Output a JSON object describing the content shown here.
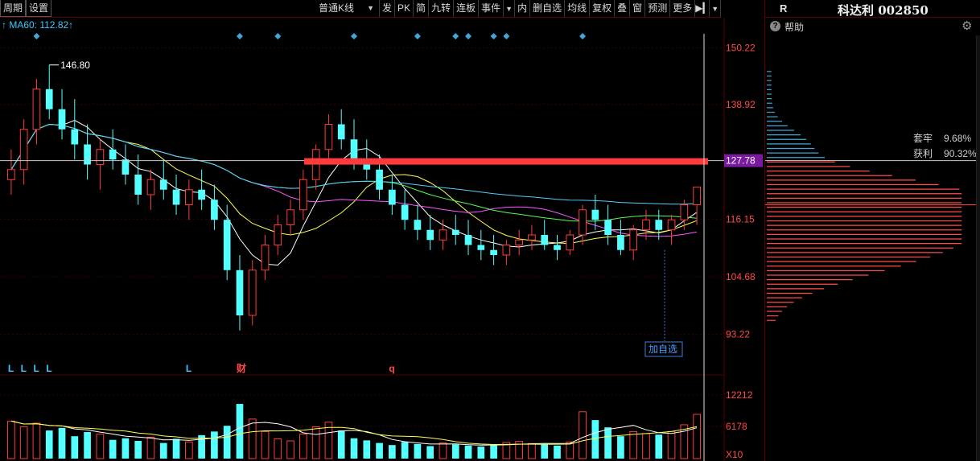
{
  "toolbar": {
    "period_label": "周期",
    "settings_label": "设置",
    "kline_type": "普通K线",
    "items": [
      "发",
      "PK",
      "简",
      "九转",
      "连板",
      "事件",
      "内",
      "删自选",
      "均线",
      "复权",
      "叠",
      "窗",
      "预测",
      "更多"
    ]
  },
  "ma_label": "MA60: 112.82",
  "axis": {
    "price_ticks": [
      "150.22",
      "138.92",
      "127.78",
      "116.15",
      "104.68",
      "93.22"
    ],
    "volume_ticks": [
      "12212",
      "6178"
    ],
    "volume_unit": "X10"
  },
  "annotations": {
    "high_label": "146.80",
    "add_watchlist": "加自选",
    "markers": [
      "L",
      "L",
      "L",
      "L",
      "L",
      "财",
      "q"
    ]
  },
  "panel": {
    "r_label": "R",
    "stock_name": "科达利 002850",
    "help_label": "帮助",
    "trapped_label": "套牢",
    "trapped_value": "9.68%",
    "profit_label": "获利",
    "profit_value": "90.32%"
  },
  "colors": {
    "up": "#ff3c3c",
    "down": "#54ffff",
    "ma5": "#ffffff",
    "ma10": "#ffff55",
    "ma20": "#ff55ff",
    "ma30": "#55ff55",
    "ma60": "#55ccff",
    "highlight": "#ff3a3a",
    "diamond": "#3fa9d6"
  },
  "chart_data": {
    "type": "candlestick",
    "ylim": [
      89,
      153
    ],
    "current_price": 127.78,
    "max_price": 146.8,
    "ma60_value": 112.82,
    "candles": [
      [
        124,
        130,
        121,
        126
      ],
      [
        126,
        136,
        123,
        134
      ],
      [
        134,
        144,
        131,
        142
      ],
      [
        142,
        146.8,
        136,
        138
      ],
      [
        138,
        142,
        132,
        134
      ],
      [
        134,
        140,
        128,
        131
      ],
      [
        131,
        135,
        124,
        127
      ],
      [
        127,
        132,
        122,
        130
      ],
      [
        130,
        134,
        126,
        128
      ],
      [
        128,
        131,
        123,
        125
      ],
      [
        125,
        129,
        119,
        121
      ],
      [
        121,
        126,
        118,
        124
      ],
      [
        124,
        128,
        120,
        122
      ],
      [
        122,
        125,
        117,
        119
      ],
      [
        119,
        124,
        116,
        122
      ],
      [
        122,
        126,
        118,
        120
      ],
      [
        120,
        123,
        114,
        116
      ],
      [
        116,
        119,
        104,
        106
      ],
      [
        106,
        109,
        94,
        97
      ],
      [
        97,
        108,
        95,
        106
      ],
      [
        106,
        113,
        104,
        111
      ],
      [
        111,
        117,
        109,
        115
      ],
      [
        115,
        120,
        113,
        118
      ],
      [
        118,
        126,
        116,
        124
      ],
      [
        124,
        131,
        122,
        130
      ],
      [
        130,
        137,
        127,
        135
      ],
      [
        135,
        138,
        130,
        132
      ],
      [
        132,
        136,
        126,
        128
      ],
      [
        128,
        132,
        124,
        126
      ],
      [
        126,
        129,
        120,
        122
      ],
      [
        122,
        125,
        117,
        119
      ],
      [
        119,
        122,
        114,
        116
      ],
      [
        116,
        119,
        112,
        114
      ],
      [
        114,
        117,
        110,
        112
      ],
      [
        112,
        116,
        110,
        114
      ],
      [
        114,
        117,
        111,
        113
      ],
      [
        113,
        116,
        109,
        111
      ],
      [
        111,
        114,
        108,
        110
      ],
      [
        110,
        113,
        107,
        109
      ],
      [
        109,
        112,
        107,
        111
      ],
      [
        111,
        114,
        109,
        112
      ],
      [
        112,
        115,
        110,
        113
      ],
      [
        113,
        116,
        110,
        111
      ],
      [
        111,
        113,
        108,
        110
      ],
      [
        110,
        114,
        109,
        113
      ],
      [
        113,
        119,
        111,
        118
      ],
      [
        118,
        121,
        114,
        116
      ],
      [
        116,
        119,
        111,
        113
      ],
      [
        113,
        116,
        109,
        110
      ],
      [
        110,
        115,
        108,
        114
      ],
      [
        114,
        118,
        112,
        116
      ],
      [
        116,
        118,
        112,
        114
      ],
      [
        114,
        117,
        111,
        116
      ],
      [
        116,
        120,
        114,
        119
      ],
      [
        119,
        121,
        115,
        122.5
      ]
    ],
    "volume": [
      720,
      610,
      680,
      540,
      590,
      430,
      510,
      470,
      360,
      390,
      340,
      410,
      300,
      380,
      320,
      450,
      520,
      630,
      1050,
      760,
      520,
      380,
      340,
      470,
      610,
      700,
      540,
      390,
      350,
      300,
      260,
      320,
      280,
      240,
      300,
      270,
      250,
      230,
      260,
      310,
      330,
      290,
      270,
      250,
      320,
      900,
      740,
      600,
      430,
      520,
      480,
      460,
      520,
      650,
      850
    ],
    "diamond_count": 11,
    "chip_trapped_pct": 9.68,
    "chip_profit_pct": 90.32
  }
}
